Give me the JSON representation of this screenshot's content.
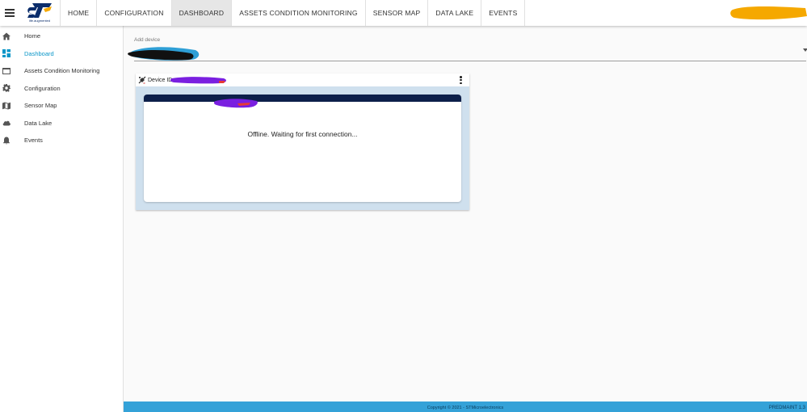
{
  "header": {
    "logo_tagline": "life.augmented",
    "nav": [
      {
        "label": "HOME",
        "active": false
      },
      {
        "label": "CONFIGURATION",
        "active": false
      },
      {
        "label": "DASHBOARD",
        "active": true
      },
      {
        "label": "ASSETS CONDITION MONITORING",
        "active": false
      },
      {
        "label": "SENSOR MAP",
        "active": false
      },
      {
        "label": "DATA LAKE",
        "active": false
      },
      {
        "label": "EVENTS",
        "active": false
      }
    ]
  },
  "sidebar": {
    "items": [
      {
        "label": "Home",
        "icon": "home-icon",
        "active": false
      },
      {
        "label": "Dashboard",
        "icon": "dashboard-icon",
        "active": true
      },
      {
        "label": "Assets Condition Monitoring",
        "icon": "window-icon",
        "active": false
      },
      {
        "label": "Configuration",
        "icon": "gear-icon",
        "active": false
      },
      {
        "label": "Sensor Map",
        "icon": "map-icon",
        "active": false
      },
      {
        "label": "Data Lake",
        "icon": "cloud-icon",
        "active": false
      },
      {
        "label": "Events",
        "icon": "bell-icon",
        "active": false
      }
    ]
  },
  "device_select": {
    "label": "Add device"
  },
  "device_card": {
    "title": "Device ID :",
    "status": "Offline. Waiting for first connection..."
  },
  "footer": {
    "copyright": "Copyright © 2021 - STMicroelectronics",
    "version": "PREDMAINT 1.3"
  },
  "colors": {
    "accent": "#0a96c8",
    "footer_bg": "#34a2d8",
    "card_bg": "#cfe0ee",
    "inner_bar": "#0c1f4a",
    "redaction_user": "#f5a800",
    "redaction_device": "#7a1fe0"
  }
}
